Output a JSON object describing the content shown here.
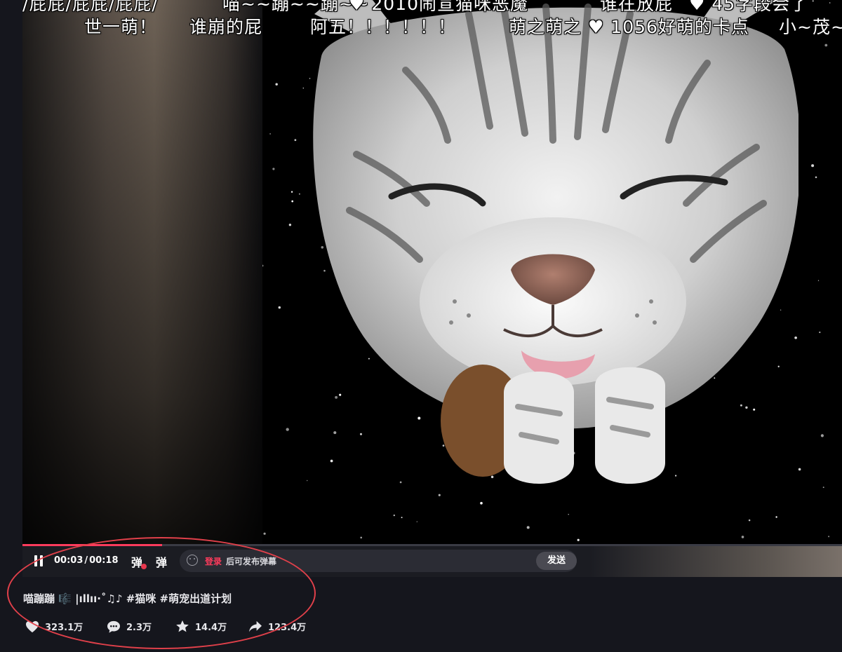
{
  "danmaku": {
    "row1": [
      "/屁屁/屁屁/屁屁/",
      "喵~~蹦~~蹦~~",
      "♥ 2010闹宣猫咪恶魔",
      "谁在放屁",
      "♥ 45字段会了"
    ],
    "row2": [
      "世一萌！",
      "谁崩的屁",
      "阿五！！！！！！",
      "萌之萌之 ♥ 1056好萌的卡点",
      "小~茂~蜜"
    ]
  },
  "player": {
    "current_time": "00:03",
    "time_separator": "/",
    "duration": "00:18",
    "danmaku_toggle_label": "弹",
    "danmaku_settings_label": "弹",
    "login_link": "登录",
    "input_hint": "后可发布弹幕",
    "send_label": "发送",
    "progress_fraction": 0.17
  },
  "video_info": {
    "title": "喵蹦蹦 🎼 |ıllıı·˚♫♪ #猫咪 #萌宠出道计划"
  },
  "stats": {
    "likes": "323.1万",
    "comments": "2.3万",
    "favorites": "14.4万",
    "shares": "123.4万"
  },
  "icons": {
    "likes": "heart-icon",
    "comments": "comment-bubble-icon",
    "favorites": "star-icon",
    "shares": "share-arrow-icon",
    "emoji": "smiley-icon",
    "pause": "pause-icon"
  },
  "colors": {
    "accent_red": "#ff3b5c",
    "page_bg": "#15161d",
    "annotation_circle": "#e0404a"
  }
}
